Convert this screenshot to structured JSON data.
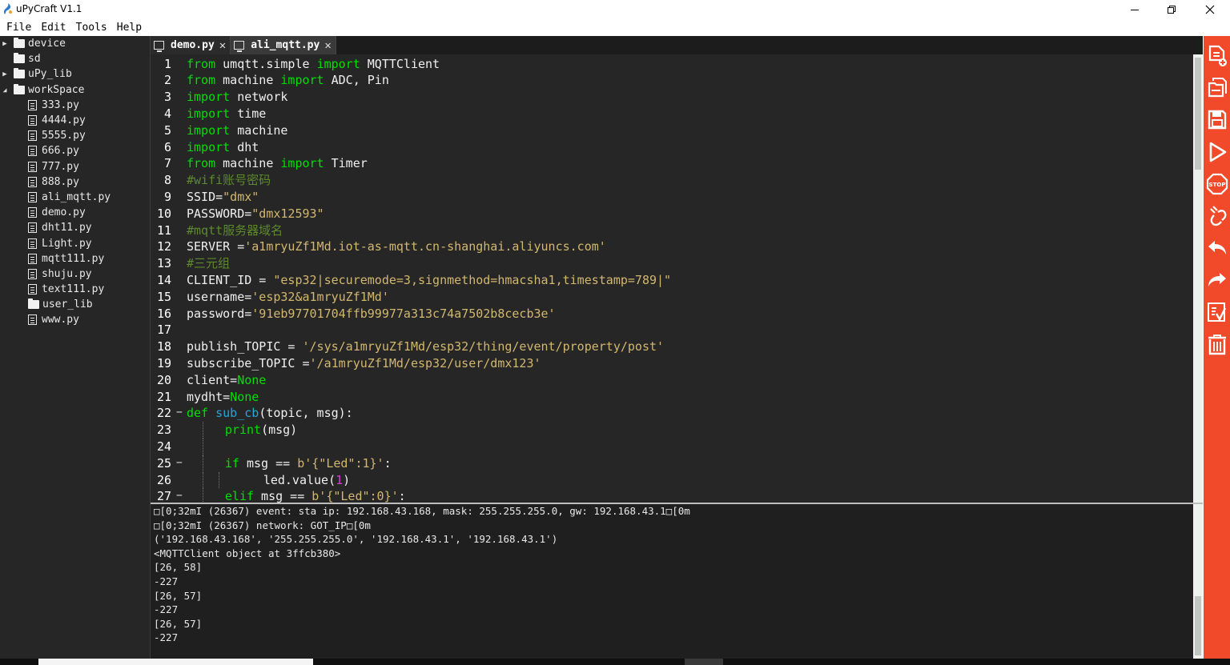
{
  "window": {
    "title": "uPyCraft V1.1"
  },
  "menu": [
    "File",
    "Edit",
    "Tools",
    "Help"
  ],
  "file_tree": [
    {
      "label": "device",
      "kind": "folder",
      "level": 0,
      "expanded": false
    },
    {
      "label": "sd",
      "kind": "folder",
      "level": 0,
      "expanded": null
    },
    {
      "label": "uPy_lib",
      "kind": "folder",
      "level": 0,
      "expanded": false
    },
    {
      "label": "workSpace",
      "kind": "folder",
      "level": 0,
      "expanded": true
    },
    {
      "label": "333.py",
      "kind": "file",
      "level": 1
    },
    {
      "label": "4444.py",
      "kind": "file",
      "level": 1
    },
    {
      "label": "5555.py",
      "kind": "file",
      "level": 1
    },
    {
      "label": "666.py",
      "kind": "file",
      "level": 1
    },
    {
      "label": "777.py",
      "kind": "file",
      "level": 1
    },
    {
      "label": "888.py",
      "kind": "file",
      "level": 1
    },
    {
      "label": "ali_mqtt.py",
      "kind": "file",
      "level": 1
    },
    {
      "label": "demo.py",
      "kind": "file",
      "level": 1
    },
    {
      "label": "dht11.py",
      "kind": "file",
      "level": 1
    },
    {
      "label": "Light.py",
      "kind": "file",
      "level": 1
    },
    {
      "label": "mqtt111.py",
      "kind": "file",
      "level": 1
    },
    {
      "label": "shuju.py",
      "kind": "file",
      "level": 1
    },
    {
      "label": "text111.py",
      "kind": "file",
      "level": 1
    },
    {
      "label": "user_lib",
      "kind": "folder",
      "level": 1
    },
    {
      "label": "www.py",
      "kind": "file",
      "level": 1
    }
  ],
  "tabs": [
    {
      "label": "demo.py",
      "active": false
    },
    {
      "label": "ali_mqtt.py",
      "active": true
    }
  ],
  "code_lines": [
    {
      "n": "1",
      "fold": "",
      "indent": 0,
      "tokens": [
        [
          "kw",
          "from"
        ],
        [
          "t",
          " umqtt.simple "
        ],
        [
          "kw",
          "import"
        ],
        [
          "t",
          " MQTTClient"
        ]
      ]
    },
    {
      "n": "2",
      "fold": "",
      "indent": 0,
      "tokens": [
        [
          "kw",
          "from"
        ],
        [
          "t",
          " machine "
        ],
        [
          "kw",
          "import"
        ],
        [
          "t",
          " ADC, Pin"
        ]
      ]
    },
    {
      "n": "3",
      "fold": "",
      "indent": 0,
      "tokens": [
        [
          "kw",
          "import"
        ],
        [
          "t",
          " network"
        ]
      ]
    },
    {
      "n": "4",
      "fold": "",
      "indent": 0,
      "tokens": [
        [
          "kw",
          "import"
        ],
        [
          "t",
          " time"
        ]
      ]
    },
    {
      "n": "5",
      "fold": "",
      "indent": 0,
      "tokens": [
        [
          "kw",
          "import"
        ],
        [
          "t",
          " machine"
        ]
      ]
    },
    {
      "n": "6",
      "fold": "",
      "indent": 0,
      "tokens": [
        [
          "kw",
          "import"
        ],
        [
          "t",
          " dht"
        ]
      ]
    },
    {
      "n": "7",
      "fold": "",
      "indent": 0,
      "tokens": [
        [
          "kw",
          "from"
        ],
        [
          "t",
          " machine "
        ],
        [
          "kw",
          "import"
        ],
        [
          "t",
          " Timer"
        ]
      ]
    },
    {
      "n": "8",
      "fold": "",
      "indent": 0,
      "tokens": [
        [
          "cm",
          "#wifi账号密码"
        ]
      ]
    },
    {
      "n": "9",
      "fold": "",
      "indent": 0,
      "tokens": [
        [
          "t",
          "SSID="
        ],
        [
          "str",
          "\"dmx\""
        ]
      ]
    },
    {
      "n": "10",
      "fold": "",
      "indent": 0,
      "tokens": [
        [
          "t",
          "PASSWORD="
        ],
        [
          "str",
          "\"dmx12593\""
        ]
      ]
    },
    {
      "n": "11",
      "fold": "",
      "indent": 0,
      "tokens": [
        [
          "cm",
          "#mqtt服务器域名"
        ]
      ]
    },
    {
      "n": "12",
      "fold": "",
      "indent": 0,
      "tokens": [
        [
          "t",
          "SERVER ="
        ],
        [
          "str",
          "'a1mryuZf1Md.iot-as-mqtt.cn-shanghai.aliyuncs.com'"
        ]
      ]
    },
    {
      "n": "13",
      "fold": "",
      "indent": 0,
      "tokens": [
        [
          "cm",
          "#三元组"
        ]
      ]
    },
    {
      "n": "14",
      "fold": "",
      "indent": 0,
      "tokens": [
        [
          "t",
          "CLIENT_ID = "
        ],
        [
          "str",
          "\"esp32|securemode=3,signmethod=hmacsha1,timestamp=789|\""
        ]
      ]
    },
    {
      "n": "15",
      "fold": "",
      "indent": 0,
      "tokens": [
        [
          "t",
          "username="
        ],
        [
          "str",
          "'esp32&a1mryuZf1Md'"
        ]
      ]
    },
    {
      "n": "16",
      "fold": "",
      "indent": 0,
      "tokens": [
        [
          "t",
          "password="
        ],
        [
          "str",
          "'91eb97701704ffb99977a313c74a7502b8cecb3e'"
        ]
      ]
    },
    {
      "n": "17",
      "fold": "",
      "indent": 0,
      "tokens": []
    },
    {
      "n": "18",
      "fold": "",
      "indent": 0,
      "tokens": [
        [
          "t",
          "publish_TOPIC = "
        ],
        [
          "str",
          "'/sys/a1mryuZf1Md/esp32/thing/event/property/post'"
        ]
      ]
    },
    {
      "n": "19",
      "fold": "",
      "indent": 0,
      "tokens": [
        [
          "t",
          "subscribe_TOPIC ="
        ],
        [
          "str",
          "'/a1mryuZf1Md/esp32/user/dmx123'"
        ]
      ]
    },
    {
      "n": "20",
      "fold": "",
      "indent": 0,
      "tokens": [
        [
          "t",
          "client="
        ],
        [
          "kw",
          "None"
        ]
      ]
    },
    {
      "n": "21",
      "fold": "",
      "indent": 0,
      "tokens": [
        [
          "t",
          "mydht="
        ],
        [
          "kw",
          "None"
        ]
      ]
    },
    {
      "n": "22",
      "fold": "-",
      "indent": 0,
      "tokens": [
        [
          "kw",
          "def"
        ],
        [
          "t",
          " "
        ],
        [
          "fn",
          "sub_cb"
        ],
        [
          "t",
          "(topic, msg):"
        ]
      ]
    },
    {
      "n": "23",
      "fold": "",
      "indent": 1,
      "tokens": [
        [
          "kw",
          "print"
        ],
        [
          "t",
          "(msg)"
        ]
      ]
    },
    {
      "n": "24",
      "fold": "",
      "indent": 1,
      "tokens": []
    },
    {
      "n": "25",
      "fold": "-",
      "indent": 1,
      "tokens": [
        [
          "kw",
          "if"
        ],
        [
          "t",
          " msg == "
        ],
        [
          "str",
          "b'{\"Led\":1}'"
        ],
        [
          "t",
          ":"
        ]
      ]
    },
    {
      "n": "26",
      "fold": "",
      "indent": 2,
      "tokens": [
        [
          "t",
          "led.value("
        ],
        [
          "num",
          "1"
        ],
        [
          "t",
          ")"
        ]
      ]
    },
    {
      "n": "27",
      "fold": "-",
      "indent": 1,
      "tokens": [
        [
          "kw",
          "elif"
        ],
        [
          "t",
          " msg == "
        ],
        [
          "str",
          "b'{\"Led\":0}'"
        ],
        [
          "t",
          ":"
        ]
      ]
    }
  ],
  "terminal_lines": [
    "\u0000[0;32mI (26367) event: sta ip: 192.168.43.168, mask: 255.255.255.0, gw: 192.168.43.1\u0000[0m",
    "\u0000[0;32mI (26367) network: GOT_IP\u0000[0m",
    "('192.168.43.168', '255.255.255.0', '192.168.43.1', '192.168.43.1')",
    "<MQTTClient object at 3ffcb380>",
    "[26, 58]",
    "-227",
    "[26, 57]",
    "-227",
    "[26, 57]",
    "-227"
  ],
  "toolbar": [
    {
      "icon": "new-file-icon"
    },
    {
      "icon": "open-file-icon"
    },
    {
      "icon": "save-icon"
    },
    {
      "icon": "download-and-run-icon"
    },
    {
      "icon": "stop-icon"
    },
    {
      "icon": "connect-icon"
    },
    {
      "icon": "undo-icon"
    },
    {
      "icon": "redo-icon"
    },
    {
      "icon": "syntax-check-icon"
    },
    {
      "icon": "clear-icon"
    }
  ],
  "colors": {
    "editor_bg": "#262626",
    "keyword": "#00e000",
    "string": "#d2b76e",
    "comment": "#5d8a2a",
    "function": "#24a6d8",
    "number": "#d23fd6",
    "toolbar": "#f04a2b"
  }
}
